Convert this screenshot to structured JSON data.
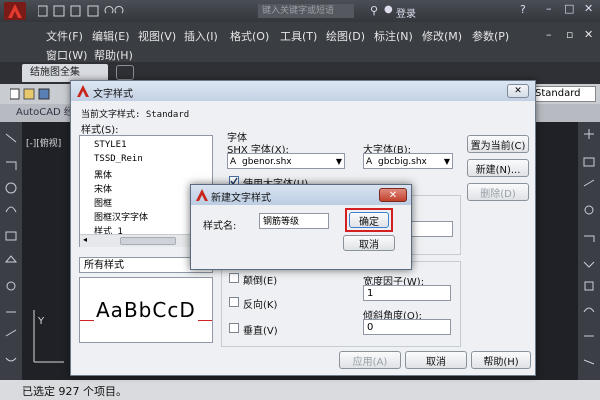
{
  "menu": {
    "items": [
      "文件(F)",
      "编辑(E)",
      "视图(V)",
      "插入(I)",
      "格式(O)",
      "工具(T)",
      "绘图(D)",
      "标注(N)",
      "修改(M)",
      "参数(P)"
    ],
    "items_row2": [
      "窗口(W)",
      "帮助(H)"
    ]
  },
  "titlebar": {
    "search_placeholder": "键入关键字或短语",
    "user": "登录"
  },
  "tabs": {
    "doc": "结施图全集"
  },
  "toolbar": {
    "style_value": "Standard"
  },
  "infobar": {
    "text": "AutoCAD 经典"
  },
  "view_label": "[-][俯视]",
  "dialog": {
    "title": "文字样式",
    "current_style": "当前文字样式:  Standard",
    "styles_label": "样式(S):",
    "styles": [
      "STYLE1",
      "TSSD_Rein",
      "黑体",
      "宋体",
      "图框",
      "图框汉字字体",
      "样式 1"
    ],
    "filter_value": "所有样式",
    "preview_text": "AaBbCcD",
    "font_group": "字体",
    "shx_label": "SHX 字体(X):",
    "shx_value": "gbenor.shx",
    "bigfont_label": "大字体(B):",
    "bigfont_value": "gbcbig.shx",
    "use_bigfont": "使用大字体(U)",
    "upside_down": "颠倒(E)",
    "backwards": "反向(K)",
    "vertical": "垂直(V)",
    "width_label": "宽度因子(W):",
    "width_value": "1",
    "oblique_label": "倾斜角度(O):",
    "oblique_value": "0",
    "set_current": "置为当前(C)",
    "new": "新建(N)...",
    "delete": "删除(D)",
    "apply": "应用(A)",
    "cancel": "取消",
    "help": "帮助(H)"
  },
  "new_dialog": {
    "title": "新建文字样式",
    "name_label": "样式名:",
    "name_value": "钢筋等级",
    "ok": "确定",
    "cancel": "取消"
  },
  "command": {
    "line": "已选定 927 个项目。"
  },
  "colors": {
    "accent_red": "#d42020",
    "title_blue": "#c3d1e4"
  }
}
